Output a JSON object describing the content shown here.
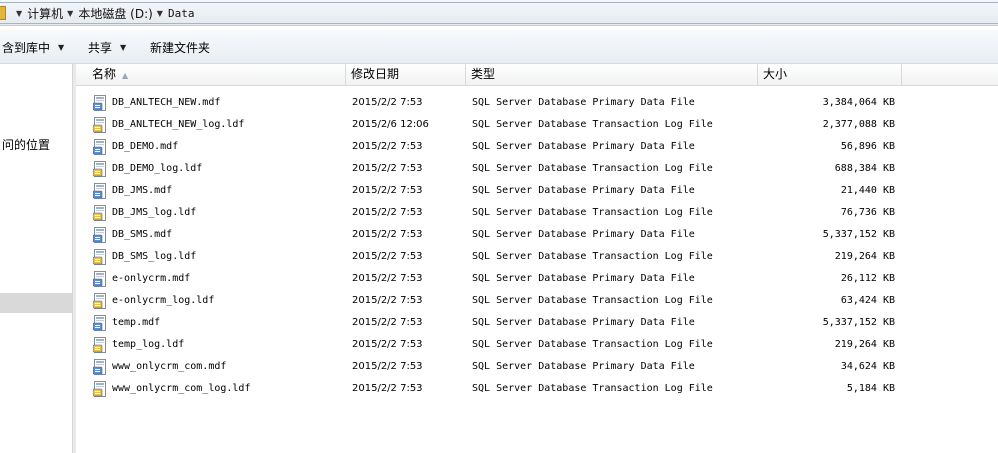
{
  "address": {
    "segments": [
      "计算机",
      "本地磁盘 (D:)",
      "Data"
    ]
  },
  "toolbar": {
    "include_library": "含到库中",
    "share": "共享",
    "new_folder": "新建文件夹"
  },
  "nav": {
    "partial_item": "问的位置"
  },
  "columns": {
    "name": "名称",
    "date": "修改日期",
    "type": "类型",
    "size": "大小"
  },
  "files": [
    {
      "name": "DB_ANLTECH_NEW.mdf",
      "date": "2015/2/2 7:53",
      "type": "SQL Server Database Primary Data File",
      "size": "3,384,064 KB",
      "icon": "sql-data-file-icon"
    },
    {
      "name": "DB_ANLTECH_NEW_log.ldf",
      "date": "2015/2/6 12:06",
      "type": "SQL Server Database Transaction Log File",
      "size": "2,377,088 KB",
      "icon": "sql-log-file-icon"
    },
    {
      "name": "DB_DEMO.mdf",
      "date": "2015/2/2 7:53",
      "type": "SQL Server Database Primary Data File",
      "size": "56,896 KB",
      "icon": "sql-data-file-icon"
    },
    {
      "name": "DB_DEMO_log.ldf",
      "date": "2015/2/2 7:53",
      "type": "SQL Server Database Transaction Log File",
      "size": "688,384 KB",
      "icon": "sql-log-file-icon"
    },
    {
      "name": "DB_JMS.mdf",
      "date": "2015/2/2 7:53",
      "type": "SQL Server Database Primary Data File",
      "size": "21,440 KB",
      "icon": "sql-data-file-icon"
    },
    {
      "name": "DB_JMS_log.ldf",
      "date": "2015/2/2 7:53",
      "type": "SQL Server Database Transaction Log File",
      "size": "76,736 KB",
      "icon": "sql-log-file-icon"
    },
    {
      "name": "DB_SMS.mdf",
      "date": "2015/2/2 7:53",
      "type": "SQL Server Database Primary Data File",
      "size": "5,337,152 KB",
      "icon": "sql-data-file-icon"
    },
    {
      "name": "DB_SMS_log.ldf",
      "date": "2015/2/2 7:53",
      "type": "SQL Server Database Transaction Log File",
      "size": "219,264 KB",
      "icon": "sql-log-file-icon"
    },
    {
      "name": "e-onlycrm.mdf",
      "date": "2015/2/2 7:53",
      "type": "SQL Server Database Primary Data File",
      "size": "26,112 KB",
      "icon": "sql-data-file-icon"
    },
    {
      "name": "e-onlycrm_log.ldf",
      "date": "2015/2/2 7:53",
      "type": "SQL Server Database Transaction Log File",
      "size": "63,424 KB",
      "icon": "sql-log-file-icon"
    },
    {
      "name": "temp.mdf",
      "date": "2015/2/2 7:53",
      "type": "SQL Server Database Primary Data File",
      "size": "5,337,152 KB",
      "icon": "sql-data-file-icon"
    },
    {
      "name": "temp_log.ldf",
      "date": "2015/2/2 7:53",
      "type": "SQL Server Database Transaction Log File",
      "size": "219,264 KB",
      "icon": "sql-log-file-icon"
    },
    {
      "name": "www_onlycrm_com.mdf",
      "date": "2015/2/2 7:53",
      "type": "SQL Server Database Primary Data File",
      "size": "34,624 KB",
      "icon": "sql-data-file-icon"
    },
    {
      "name": "www_onlycrm_com_log.ldf",
      "date": "2015/2/2 7:53",
      "type": "SQL Server Database Transaction Log File",
      "size": "5,184 KB",
      "icon": "sql-log-file-icon"
    }
  ]
}
